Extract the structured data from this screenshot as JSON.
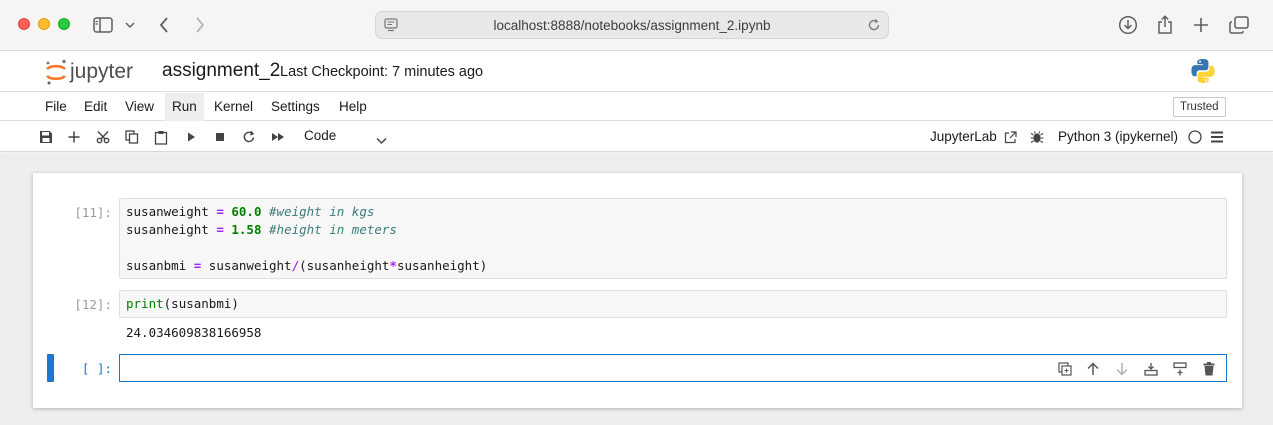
{
  "browser": {
    "url": "localhost:8888/notebooks/assignment_2.ipynb",
    "icons": [
      "sidebar-icon",
      "chevron-down-icon",
      "back-icon",
      "forward-icon",
      "reader-icon",
      "reload-icon",
      "download-icon",
      "share-icon",
      "new-tab-icon",
      "tabs-icon"
    ]
  },
  "header": {
    "logo_text": "jupyter",
    "notebook_name": "assignment_2",
    "checkpoint": "Last Checkpoint: 7 minutes ago"
  },
  "menu": {
    "items": [
      "File",
      "Edit",
      "View",
      "Run",
      "Kernel",
      "Settings",
      "Help"
    ],
    "active": "Run",
    "trusted": "Trusted"
  },
  "toolbar": {
    "cell_type": "Code",
    "jupyterlab_link": "JupyterLab",
    "kernel_name": "Python 3 (ipykernel)"
  },
  "cells": [
    {
      "prompt": "[11]:",
      "lines": [
        "susanweight = 60.0 #weight in kgs",
        "susanheight = 1.58 #height in meters",
        "",
        "susanbmi = susanweight/(susanheight*susanheight)"
      ]
    },
    {
      "prompt": "[12]:",
      "lines": [
        "print(susanbmi)"
      ],
      "output": "24.034609838166958"
    },
    {
      "prompt": "[ ]:",
      "lines": [
        ""
      ]
    }
  ],
  "colors": {
    "accent": "#1976d2",
    "number": "#008000",
    "operator": "#aa22ff",
    "comment": "#3d7b7b",
    "jupyter_orange": "#f37726"
  }
}
